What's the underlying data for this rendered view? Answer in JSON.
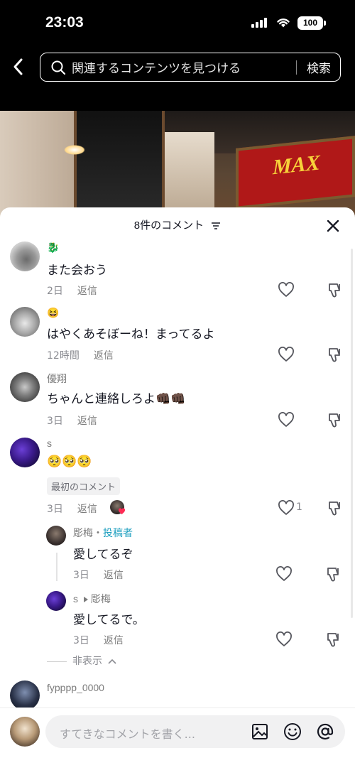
{
  "status_bar": {
    "time": "23:03",
    "battery": "100"
  },
  "search": {
    "placeholder": "関連するコンテンツを見つける",
    "button": "検索"
  },
  "video": {
    "sign_text": "MAX"
  },
  "comments_header": {
    "title": "8件のコメント"
  },
  "comments": [
    {
      "username": "",
      "emoji_name": "🐉",
      "text": "また会おう",
      "time": "2日",
      "reply": "返信"
    },
    {
      "username": "",
      "emoji_name": "😆",
      "text": "はやくあそぼーね！まってるよ",
      "time": "12時間",
      "reply": "返信"
    },
    {
      "username": "優翔",
      "text": "ちゃんと連絡しろよ👊🏿👊🏿",
      "time": "3日",
      "reply": "返信"
    },
    {
      "username": "s",
      "text": "🥺🥺🥺",
      "badge": "最初のコメント",
      "time": "3日",
      "reply": "返信",
      "like_count": "1"
    }
  ],
  "replies": [
    {
      "username": "彫梅",
      "separator": "・",
      "author_tag": "投稿者",
      "text": "愛してるぞ",
      "time": "3日",
      "reply": "返信"
    },
    {
      "username": "s",
      "reply_to": "彫梅",
      "text": "愛してるで。",
      "time": "3日",
      "reply": "返信"
    }
  ],
  "hide_replies": "非表示",
  "last_comment": {
    "username": "fypppp_0000"
  },
  "composer": {
    "placeholder": "すてきなコメントを書く..."
  },
  "colors": {
    "author_tag": "#1e9fbf",
    "heart_badge": "#fe2c55"
  },
  "icons": [
    "back-icon",
    "search-icon",
    "filter-icon",
    "close-icon",
    "heart-icon",
    "dislike-icon",
    "image-icon",
    "emoji-icon",
    "mention-icon"
  ]
}
